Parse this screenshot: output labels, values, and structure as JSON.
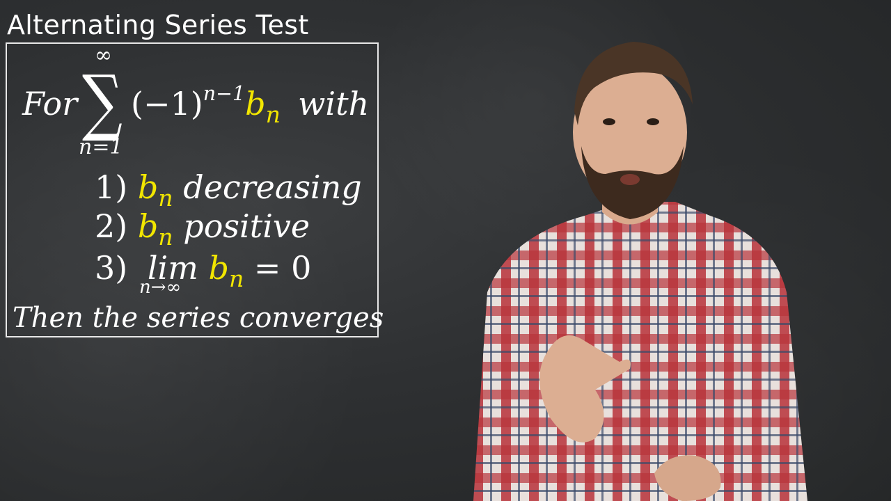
{
  "header": {
    "title": "Alternating Series Test"
  },
  "theorem": {
    "intro_for": "For",
    "sum_upper": "∞",
    "sum_symbol": "∑",
    "sum_lower": "n=1",
    "term_base": "(−1)",
    "term_exp": "n−1",
    "b_letter": "b",
    "b_sub": "n",
    "intro_with": "with",
    "cond1_num": "1)",
    "cond1_text": "decreasing",
    "cond2_num": "2)",
    "cond2_text": "positive",
    "cond3_num": "3)",
    "cond3_lim": "lim",
    "cond3_under": "n→∞",
    "cond3_eq": "= 0",
    "conclusion": "Then the series converges"
  },
  "colors": {
    "board": "#2e3032",
    "chalk": "#ffffff",
    "highlight": "#f2e600",
    "shirt_red": "#b8333a",
    "shirt_light": "#e8e0dc"
  }
}
